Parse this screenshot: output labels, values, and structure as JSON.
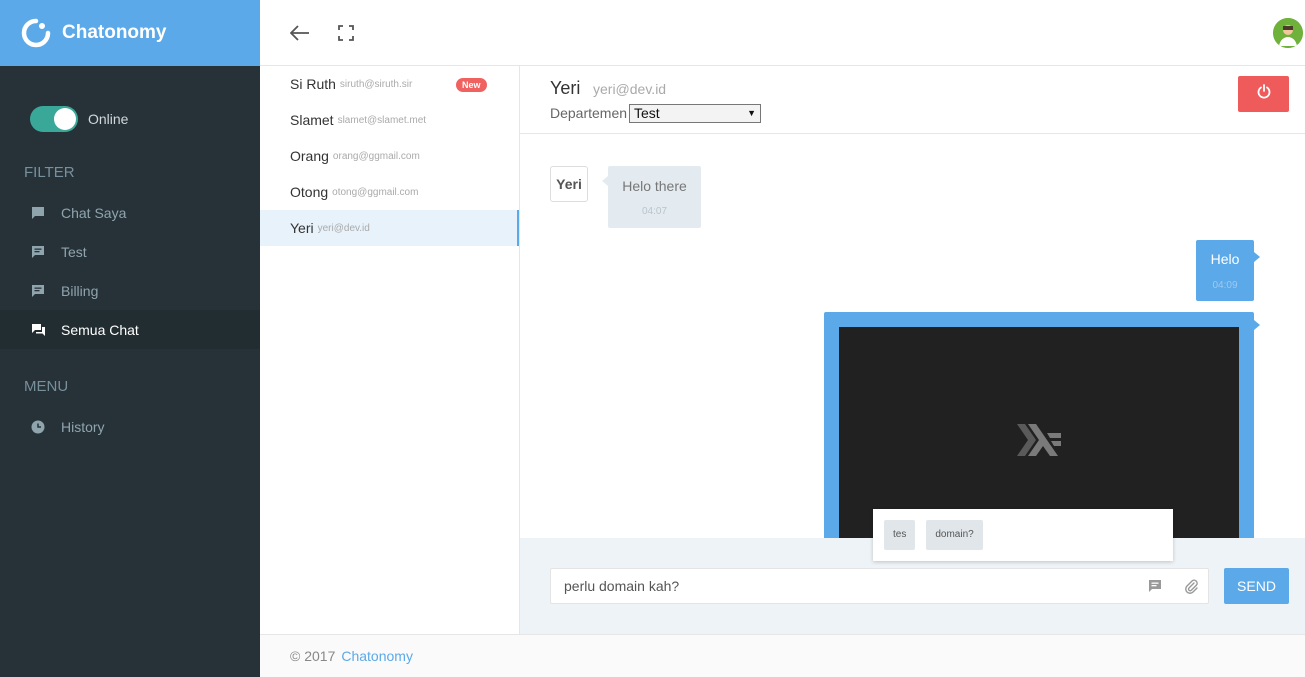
{
  "brand": {
    "name": "Chatonomy",
    "color": "#5ba9e9"
  },
  "status": {
    "label": "Online",
    "on": true
  },
  "filter": {
    "title": "FILTER",
    "items": [
      {
        "label": "Chat Saya",
        "icon": "chat-bubble-icon"
      },
      {
        "label": "Test",
        "icon": "message-icon"
      },
      {
        "label": "Billing",
        "icon": "message-icon"
      },
      {
        "label": "Semua Chat",
        "icon": "forum-icon",
        "active": true
      }
    ]
  },
  "menu": {
    "title": "MENU",
    "items": [
      {
        "label": "History",
        "icon": "clock-icon"
      }
    ]
  },
  "contacts": [
    {
      "name": "Si Ruth",
      "email": "siruth@siruth.sir",
      "badge": "New"
    },
    {
      "name": "Slamet",
      "email": "slamet@slamet.met"
    },
    {
      "name": "Orang",
      "email": "orang@ggmail.com"
    },
    {
      "name": "Otong",
      "email": "otong@ggmail.com"
    },
    {
      "name": "Yeri",
      "email": "yeri@dev.id",
      "active": true
    }
  ],
  "chat": {
    "name": "Yeri",
    "email": "yeri@dev.id",
    "department_label": "Departemen",
    "department_value": "Test",
    "messages": [
      {
        "from": "Yeri",
        "text": "Helo there",
        "time": "04:07"
      },
      {
        "from": "me",
        "text": "Helo",
        "time": "04:09"
      }
    ]
  },
  "suggestions": [
    "tes",
    "domain?"
  ],
  "composer": {
    "value": "perlu domain kah?",
    "send_label": "SEND"
  },
  "footer": {
    "copyright": "© 2017",
    "link": "Chatonomy"
  },
  "colors": {
    "danger": "#ef5b5b",
    "online": "#3aa899",
    "sidebar": "#263238"
  }
}
